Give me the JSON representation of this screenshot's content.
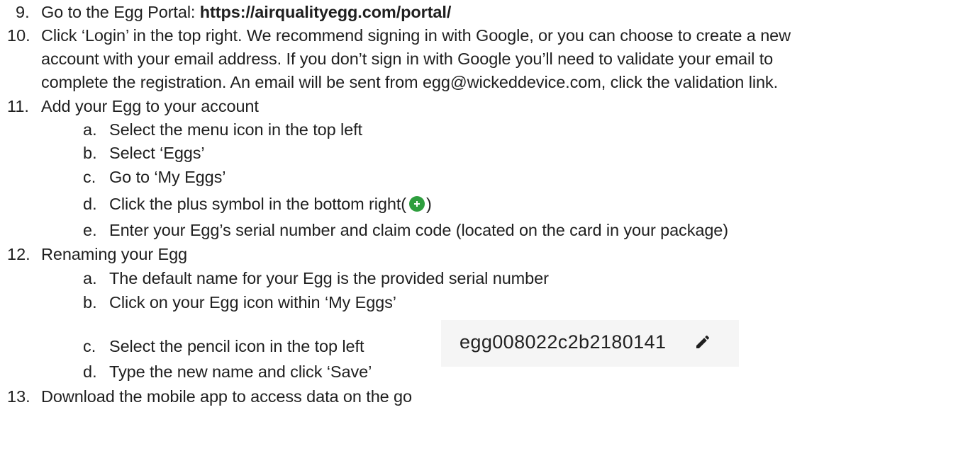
{
  "steps": [
    {
      "number": "9.",
      "text": "Go to the Egg Portal: ",
      "link": "https://airqualityegg.com/portal/"
    },
    {
      "number": "10.",
      "lines": [
        "Click ‘Login’ in the top right. We recommend signing in with Google, or you can choose to create a new",
        "account with your email address. If you don’t sign in with Google you’ll need to validate your email to",
        "complete the registration. An email will be sent from egg@wickeddevice.com, click the validation link."
      ]
    },
    {
      "number": "11.",
      "text": "Add your Egg to your account",
      "substeps": [
        {
          "letter": "a.",
          "text": "Select the menu icon in the top left"
        },
        {
          "letter": "b.",
          "text": "Select ‘Eggs’"
        },
        {
          "letter": "c.",
          "text": "Go to ‘My Eggs’"
        },
        {
          "letter": "d.",
          "text": "Click the plus symbol in the bottom right(",
          "after": ")"
        },
        {
          "letter": "e.",
          "text": "Enter your Egg’s serial number and claim code (located on the card in your package)"
        }
      ]
    },
    {
      "number": "12.",
      "text": "Renaming your Egg",
      "substeps": [
        {
          "letter": "a.",
          "text": "The default name for your Egg is the provided serial number"
        },
        {
          "letter": "b.",
          "text": "Click on your Egg icon within ‘My Eggs’"
        },
        {
          "letter": "c.",
          "text": "Select the pencil icon in the top left"
        },
        {
          "letter": "d.",
          "text": "Type the new name and click ‘Save’"
        }
      ]
    },
    {
      "number": "13.",
      "text": "Download the mobile app to access data on the go"
    }
  ],
  "egg_name_example": "egg008022c2b2180141",
  "icons": {
    "plus": "plus-circle-icon",
    "pencil": "pencil-icon"
  },
  "colors": {
    "plus_icon": "#2e9e3e",
    "text": "#1f1f1f",
    "screenshot_bg": "#f5f5f5"
  }
}
